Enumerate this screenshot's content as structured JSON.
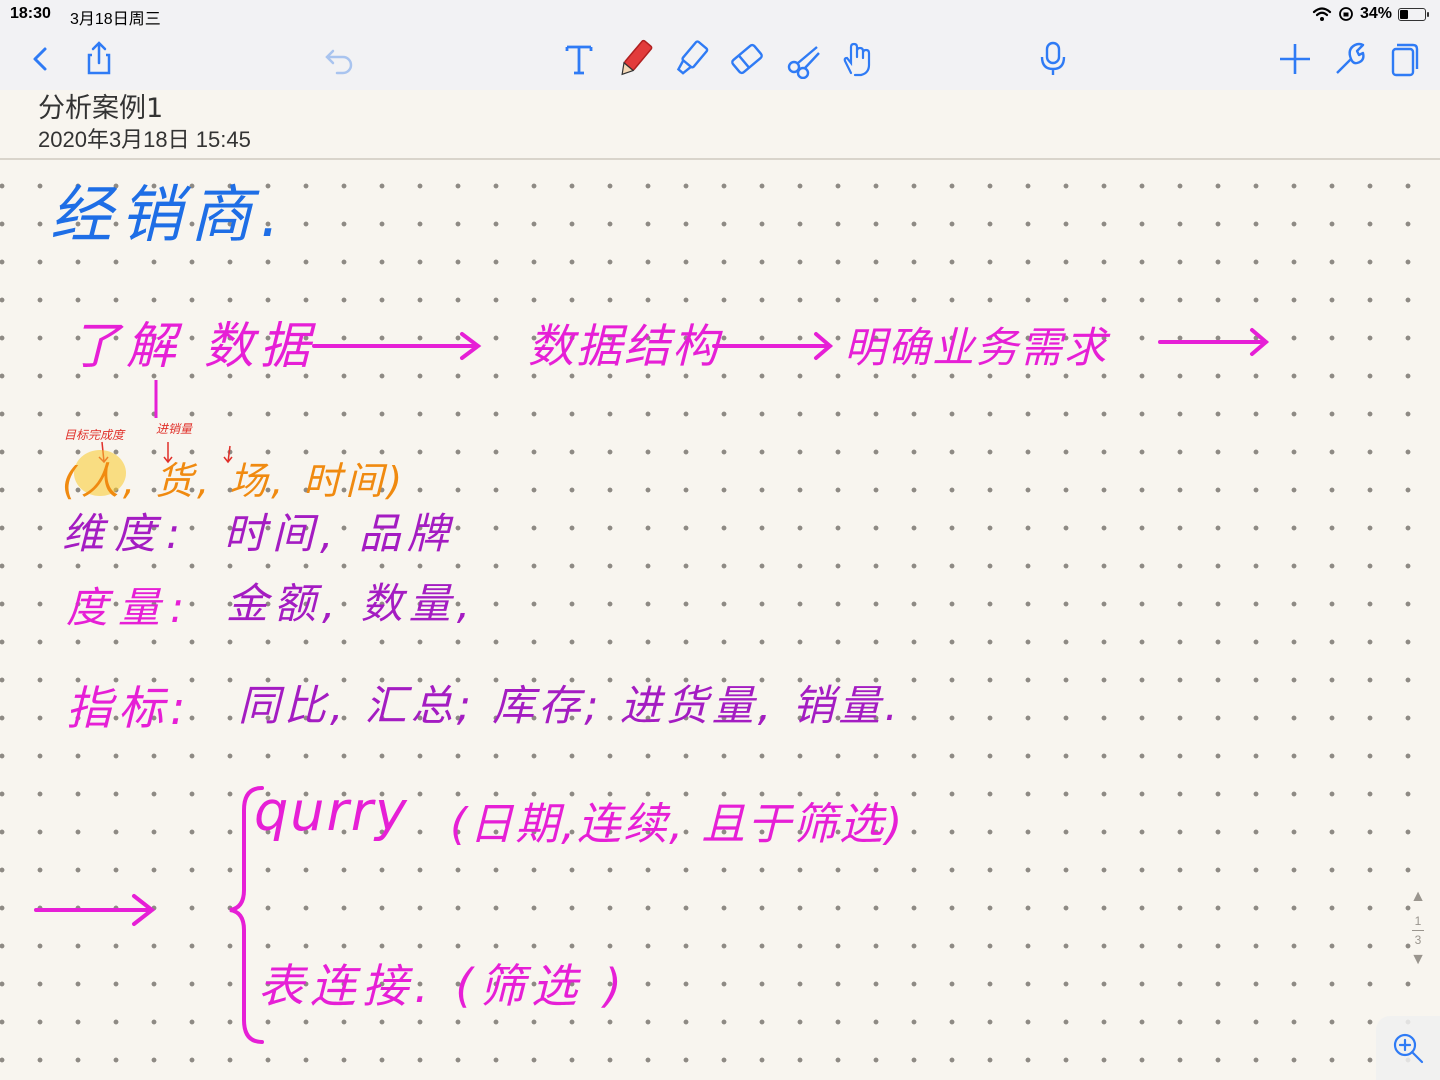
{
  "status": {
    "time": "18:30",
    "date": "3月18日周三",
    "battery": "34%",
    "battery_level": 0.34
  },
  "toolbar": {
    "left_icons": [
      "back-chevron-icon",
      "share-icon",
      "undo-icon"
    ],
    "tools": [
      "text-tool-icon",
      "pen-tool-icon",
      "highlighter-tool-icon",
      "eraser-tool-icon",
      "lasso-scissors-icon",
      "hand-tool-icon"
    ],
    "mic": "microphone-icon",
    "right_icons": [
      "add-icon",
      "wrench-icon",
      "pages-icon"
    ],
    "accent": "#2f7bf5",
    "pen_color": "#e23b3b"
  },
  "document": {
    "title": "分析案例1",
    "date": "2020年3月18日 15:45"
  },
  "notes": {
    "heading": "经销商.",
    "flow_1": "了解 数据",
    "flow_2": "数据结构",
    "flow_3": "明确业务需求",
    "anno_1": "目标完成度",
    "anno_2": "进销量",
    "items": "(人, 货, 场, 时间)",
    "dimension_label": "维度:",
    "dimension_value": "时间, 品牌",
    "measure_label": "度量:",
    "measure_value": "金额, 数量,",
    "metric_label": "指标:",
    "metric_value": "同比, 汇总; 库存; 进货量, 销量.",
    "branch_1": "qurry",
    "branch_1_note": "(日期,连续, 且于筛选)",
    "branch_2": "表连接. (筛选 )"
  },
  "pager": {
    "current": "1",
    "total": "3"
  },
  "colors": {
    "blue": "#1e6ee6",
    "pink": "#e61fd6",
    "purple": "#a41cc2",
    "orange": "#f08a10",
    "red": "#e0302a",
    "paper": "#f8f5ef"
  }
}
